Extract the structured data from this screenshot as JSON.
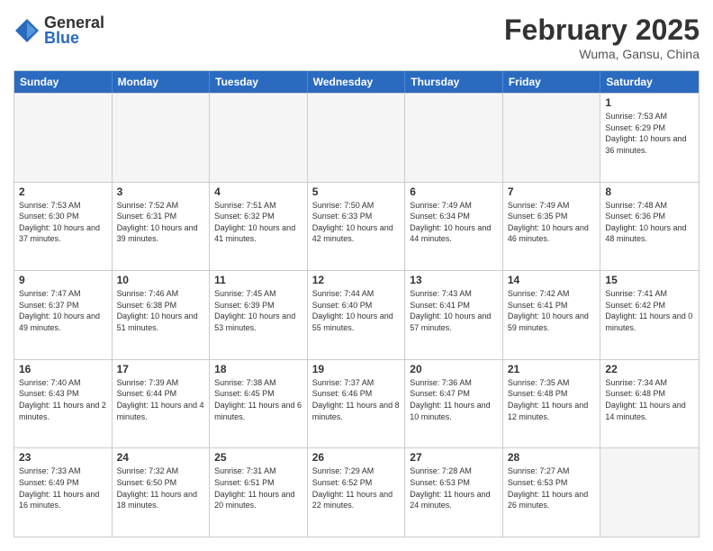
{
  "header": {
    "logo_general": "General",
    "logo_blue": "Blue",
    "month_title": "February 2025",
    "location": "Wuma, Gansu, China"
  },
  "days_of_week": [
    "Sunday",
    "Monday",
    "Tuesday",
    "Wednesday",
    "Thursday",
    "Friday",
    "Saturday"
  ],
  "weeks": [
    [
      {
        "day": "",
        "info": ""
      },
      {
        "day": "",
        "info": ""
      },
      {
        "day": "",
        "info": ""
      },
      {
        "day": "",
        "info": ""
      },
      {
        "day": "",
        "info": ""
      },
      {
        "day": "",
        "info": ""
      },
      {
        "day": "1",
        "info": "Sunrise: 7:53 AM\nSunset: 6:29 PM\nDaylight: 10 hours and 36 minutes."
      }
    ],
    [
      {
        "day": "2",
        "info": "Sunrise: 7:53 AM\nSunset: 6:30 PM\nDaylight: 10 hours and 37 minutes."
      },
      {
        "day": "3",
        "info": "Sunrise: 7:52 AM\nSunset: 6:31 PM\nDaylight: 10 hours and 39 minutes."
      },
      {
        "day": "4",
        "info": "Sunrise: 7:51 AM\nSunset: 6:32 PM\nDaylight: 10 hours and 41 minutes."
      },
      {
        "day": "5",
        "info": "Sunrise: 7:50 AM\nSunset: 6:33 PM\nDaylight: 10 hours and 42 minutes."
      },
      {
        "day": "6",
        "info": "Sunrise: 7:49 AM\nSunset: 6:34 PM\nDaylight: 10 hours and 44 minutes."
      },
      {
        "day": "7",
        "info": "Sunrise: 7:49 AM\nSunset: 6:35 PM\nDaylight: 10 hours and 46 minutes."
      },
      {
        "day": "8",
        "info": "Sunrise: 7:48 AM\nSunset: 6:36 PM\nDaylight: 10 hours and 48 minutes."
      }
    ],
    [
      {
        "day": "9",
        "info": "Sunrise: 7:47 AM\nSunset: 6:37 PM\nDaylight: 10 hours and 49 minutes."
      },
      {
        "day": "10",
        "info": "Sunrise: 7:46 AM\nSunset: 6:38 PM\nDaylight: 10 hours and 51 minutes."
      },
      {
        "day": "11",
        "info": "Sunrise: 7:45 AM\nSunset: 6:39 PM\nDaylight: 10 hours and 53 minutes."
      },
      {
        "day": "12",
        "info": "Sunrise: 7:44 AM\nSunset: 6:40 PM\nDaylight: 10 hours and 55 minutes."
      },
      {
        "day": "13",
        "info": "Sunrise: 7:43 AM\nSunset: 6:41 PM\nDaylight: 10 hours and 57 minutes."
      },
      {
        "day": "14",
        "info": "Sunrise: 7:42 AM\nSunset: 6:41 PM\nDaylight: 10 hours and 59 minutes."
      },
      {
        "day": "15",
        "info": "Sunrise: 7:41 AM\nSunset: 6:42 PM\nDaylight: 11 hours and 0 minutes."
      }
    ],
    [
      {
        "day": "16",
        "info": "Sunrise: 7:40 AM\nSunset: 6:43 PM\nDaylight: 11 hours and 2 minutes."
      },
      {
        "day": "17",
        "info": "Sunrise: 7:39 AM\nSunset: 6:44 PM\nDaylight: 11 hours and 4 minutes."
      },
      {
        "day": "18",
        "info": "Sunrise: 7:38 AM\nSunset: 6:45 PM\nDaylight: 11 hours and 6 minutes."
      },
      {
        "day": "19",
        "info": "Sunrise: 7:37 AM\nSunset: 6:46 PM\nDaylight: 11 hours and 8 minutes."
      },
      {
        "day": "20",
        "info": "Sunrise: 7:36 AM\nSunset: 6:47 PM\nDaylight: 11 hours and 10 minutes."
      },
      {
        "day": "21",
        "info": "Sunrise: 7:35 AM\nSunset: 6:48 PM\nDaylight: 11 hours and 12 minutes."
      },
      {
        "day": "22",
        "info": "Sunrise: 7:34 AM\nSunset: 6:48 PM\nDaylight: 11 hours and 14 minutes."
      }
    ],
    [
      {
        "day": "23",
        "info": "Sunrise: 7:33 AM\nSunset: 6:49 PM\nDaylight: 11 hours and 16 minutes."
      },
      {
        "day": "24",
        "info": "Sunrise: 7:32 AM\nSunset: 6:50 PM\nDaylight: 11 hours and 18 minutes."
      },
      {
        "day": "25",
        "info": "Sunrise: 7:31 AM\nSunset: 6:51 PM\nDaylight: 11 hours and 20 minutes."
      },
      {
        "day": "26",
        "info": "Sunrise: 7:29 AM\nSunset: 6:52 PM\nDaylight: 11 hours and 22 minutes."
      },
      {
        "day": "27",
        "info": "Sunrise: 7:28 AM\nSunset: 6:53 PM\nDaylight: 11 hours and 24 minutes."
      },
      {
        "day": "28",
        "info": "Sunrise: 7:27 AM\nSunset: 6:53 PM\nDaylight: 11 hours and 26 minutes."
      },
      {
        "day": "",
        "info": ""
      }
    ]
  ]
}
